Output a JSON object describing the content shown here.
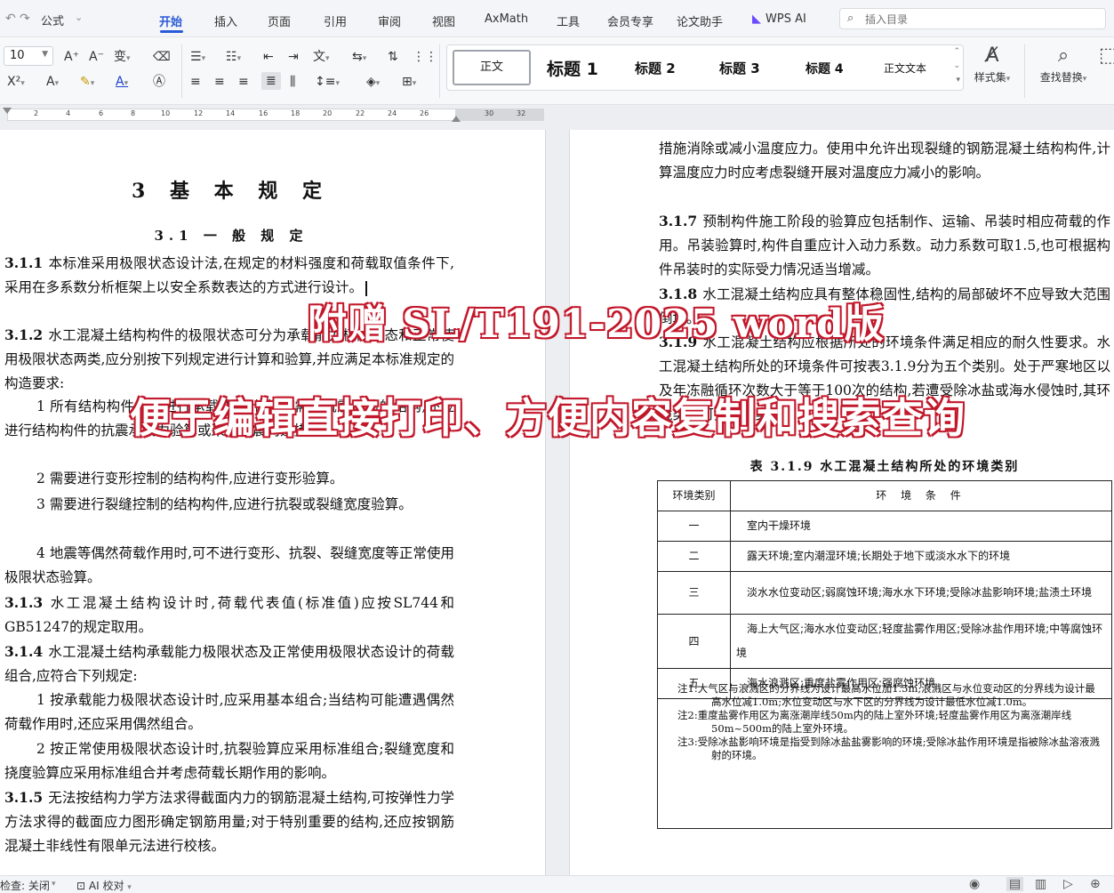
{
  "menubar": {
    "quick_format": "公式",
    "tabs": [
      "开始",
      "插入",
      "页面",
      "引用",
      "审阅",
      "视图",
      "AxMath",
      "工具",
      "会员专享",
      "论文助手"
    ],
    "active_tab": "开始",
    "wps_ai": "WPS AI",
    "search_placeholder": "插入目录"
  },
  "toolbar": {
    "font_size": "10",
    "styles": {
      "normal": "正文",
      "h1": "标题 1",
      "h2": "标题 2",
      "h3": "标题 3",
      "h4": "标题 4",
      "body_text": "正文文本"
    },
    "style_set": "样式集",
    "find_replace": "查找替换"
  },
  "ruler": {
    "ticks": [
      "2",
      "4",
      "6",
      "8",
      "10",
      "12",
      "14",
      "16",
      "18",
      "20",
      "22",
      "24",
      "26",
      "30",
      "32"
    ]
  },
  "left_page": {
    "chapter_num": "3",
    "chapter_title": "基 本 规 定",
    "section_num": "3.1",
    "section_title": "一 般 规 定",
    "p1_num": "3.1.1",
    "p1_text": "本标准采用极限状态设计法,在规定的材料强度和荷载取值条件下,采用在多系数分析框架上以安全系数表达的方式进行设计。",
    "p2_num": "3.1.2",
    "p2_text": "水工混凝土结构构件的极限状态可分为承载能力极限状态和正常使用极限状态两类,应分别按下列规定进行计算和验算,并应满足本标准规定的构造要求:",
    "p2_item1": "1 所有结构构件均应进行承载能力计算;对需要抗震设防的结构,还应进行结构构件的抗震承载力验算或采取抗震构造措施。",
    "p2_item2": "2 需要进行变形控制的结构构件,应进行变形验算。",
    "p2_item3": "3 需要进行裂缝控制的结构构件,应进行抗裂或裂缝宽度验算。",
    "p2_item4": "4 地震等偶然荷载作用时,可不进行变形、抗裂、裂缝宽度等正常使用极限状态验算。",
    "p3_num": "3.1.3",
    "p3_text": "水工混凝土结构设计时,荷载代表值(标准值)应按SL744和GB51247的规定取用。",
    "p4_num": "3.1.4",
    "p4_text": "水工混凝土结构承载能力极限状态及正常使用极限状态设计的荷载组合,应符合下列规定:",
    "p4_item1": "1 按承载能力极限状态设计时,应采用基本组合;当结构可能遭遇偶然荷载作用时,还应采用偶然组合。",
    "p4_item2": "2 按正常使用极限状态设计时,抗裂验算应采用标准组合;裂缝宽度和挠度验算应采用标准组合并考虑荷载长期作用的影响。",
    "p5_num": "3.1.5",
    "p5_text": "无法按结构力学方法求得截面内力的钢筋混凝土结构,可按弹性力学方法求得的截面应力图形确定钢筋用量;对于特别重要的结构,还应按钢筋混凝土非线性有限单元法进行校核。"
  },
  "right_page": {
    "cont_text": "措施消除或减小温度应力。使用中允许出现裂缝的钢筋混凝土结构构件,计算温度应力时应考虑裂缝开展对温度应力减小的影响。",
    "p7_num": "3.1.7",
    "p7_text": "预制构件施工阶段的验算应包括制作、运输、吊装时相应荷载的作用。吊装验算时,构件自重应计入动力系数。动力系数可取1.5,也可根据构件吊装时的实际受力情况适当增减。",
    "p8_num": "3.1.8",
    "p8_text": "水工混凝土结构应具有整体稳固性,结构的局部破坏不应导致大范围倒塌。",
    "p9_num": "3.1.9",
    "p9_text": "水工混凝土结构应根据所处的环境条件满足相应的耐久性要求。水工混凝土结构所处的环境条件可按表3.1.9分为五个类别。处于严寒地区以及年冻融循环次数大于等于100次的结构,若遭受除冰盐或海水侵蚀时,其环境类别可提高一类。",
    "table_caption": "表 3.1.9  水工混凝土结构所处的环境类别",
    "table_headers": [
      "环境类别",
      "环 境 条 件"
    ],
    "table_rows": [
      {
        "cat": "一",
        "cond": "室内干燥环境"
      },
      {
        "cat": "二",
        "cond": "露天环境;室内潮湿环境;长期处于地下或淡水水下的环境"
      },
      {
        "cat": "三",
        "cond": "淡水水位变动区;弱腐蚀环境;海水水下环境;受除冰盐影响环境;盐渍土环境"
      },
      {
        "cat": "四",
        "cond": "海上大气区;海水水位变动区;轻度盐雾作用区;受除冰盐作用环境;中等腐蚀环境"
      },
      {
        "cat": "五",
        "cond": "海水浪溅区;重度盐雾作用区;强腐蚀环境"
      }
    ],
    "notes": [
      "注1:大气区与浪溅区的分界线为设计最高水位加1.5m;浪溅区与水位变动区的分界线为设计最高水位减1.0m;水位变动区与水下区的分界线为设计最低水位减1.0m。",
      "注2:重度盐雾作用区为离涨潮岸线50m内的陆上室外环境;轻度盐雾作用区为离涨潮岸线50m~500m的陆上室外环境。",
      "注3:受除冰盐影响环境是指受到除冰盐盐雾影响的环境;受除冰盐作用环境是指被除冰盐溶液溅射的环境。"
    ]
  },
  "overlay": {
    "line1": "附赠 SL/T191-2025 word版",
    "line2": "便于编辑直接打印、方便内容复制和搜索查询",
    "color": "#c2182b"
  },
  "statusbar": {
    "proofread": "检查: 关闭",
    "ai_check": "AI 校对"
  }
}
